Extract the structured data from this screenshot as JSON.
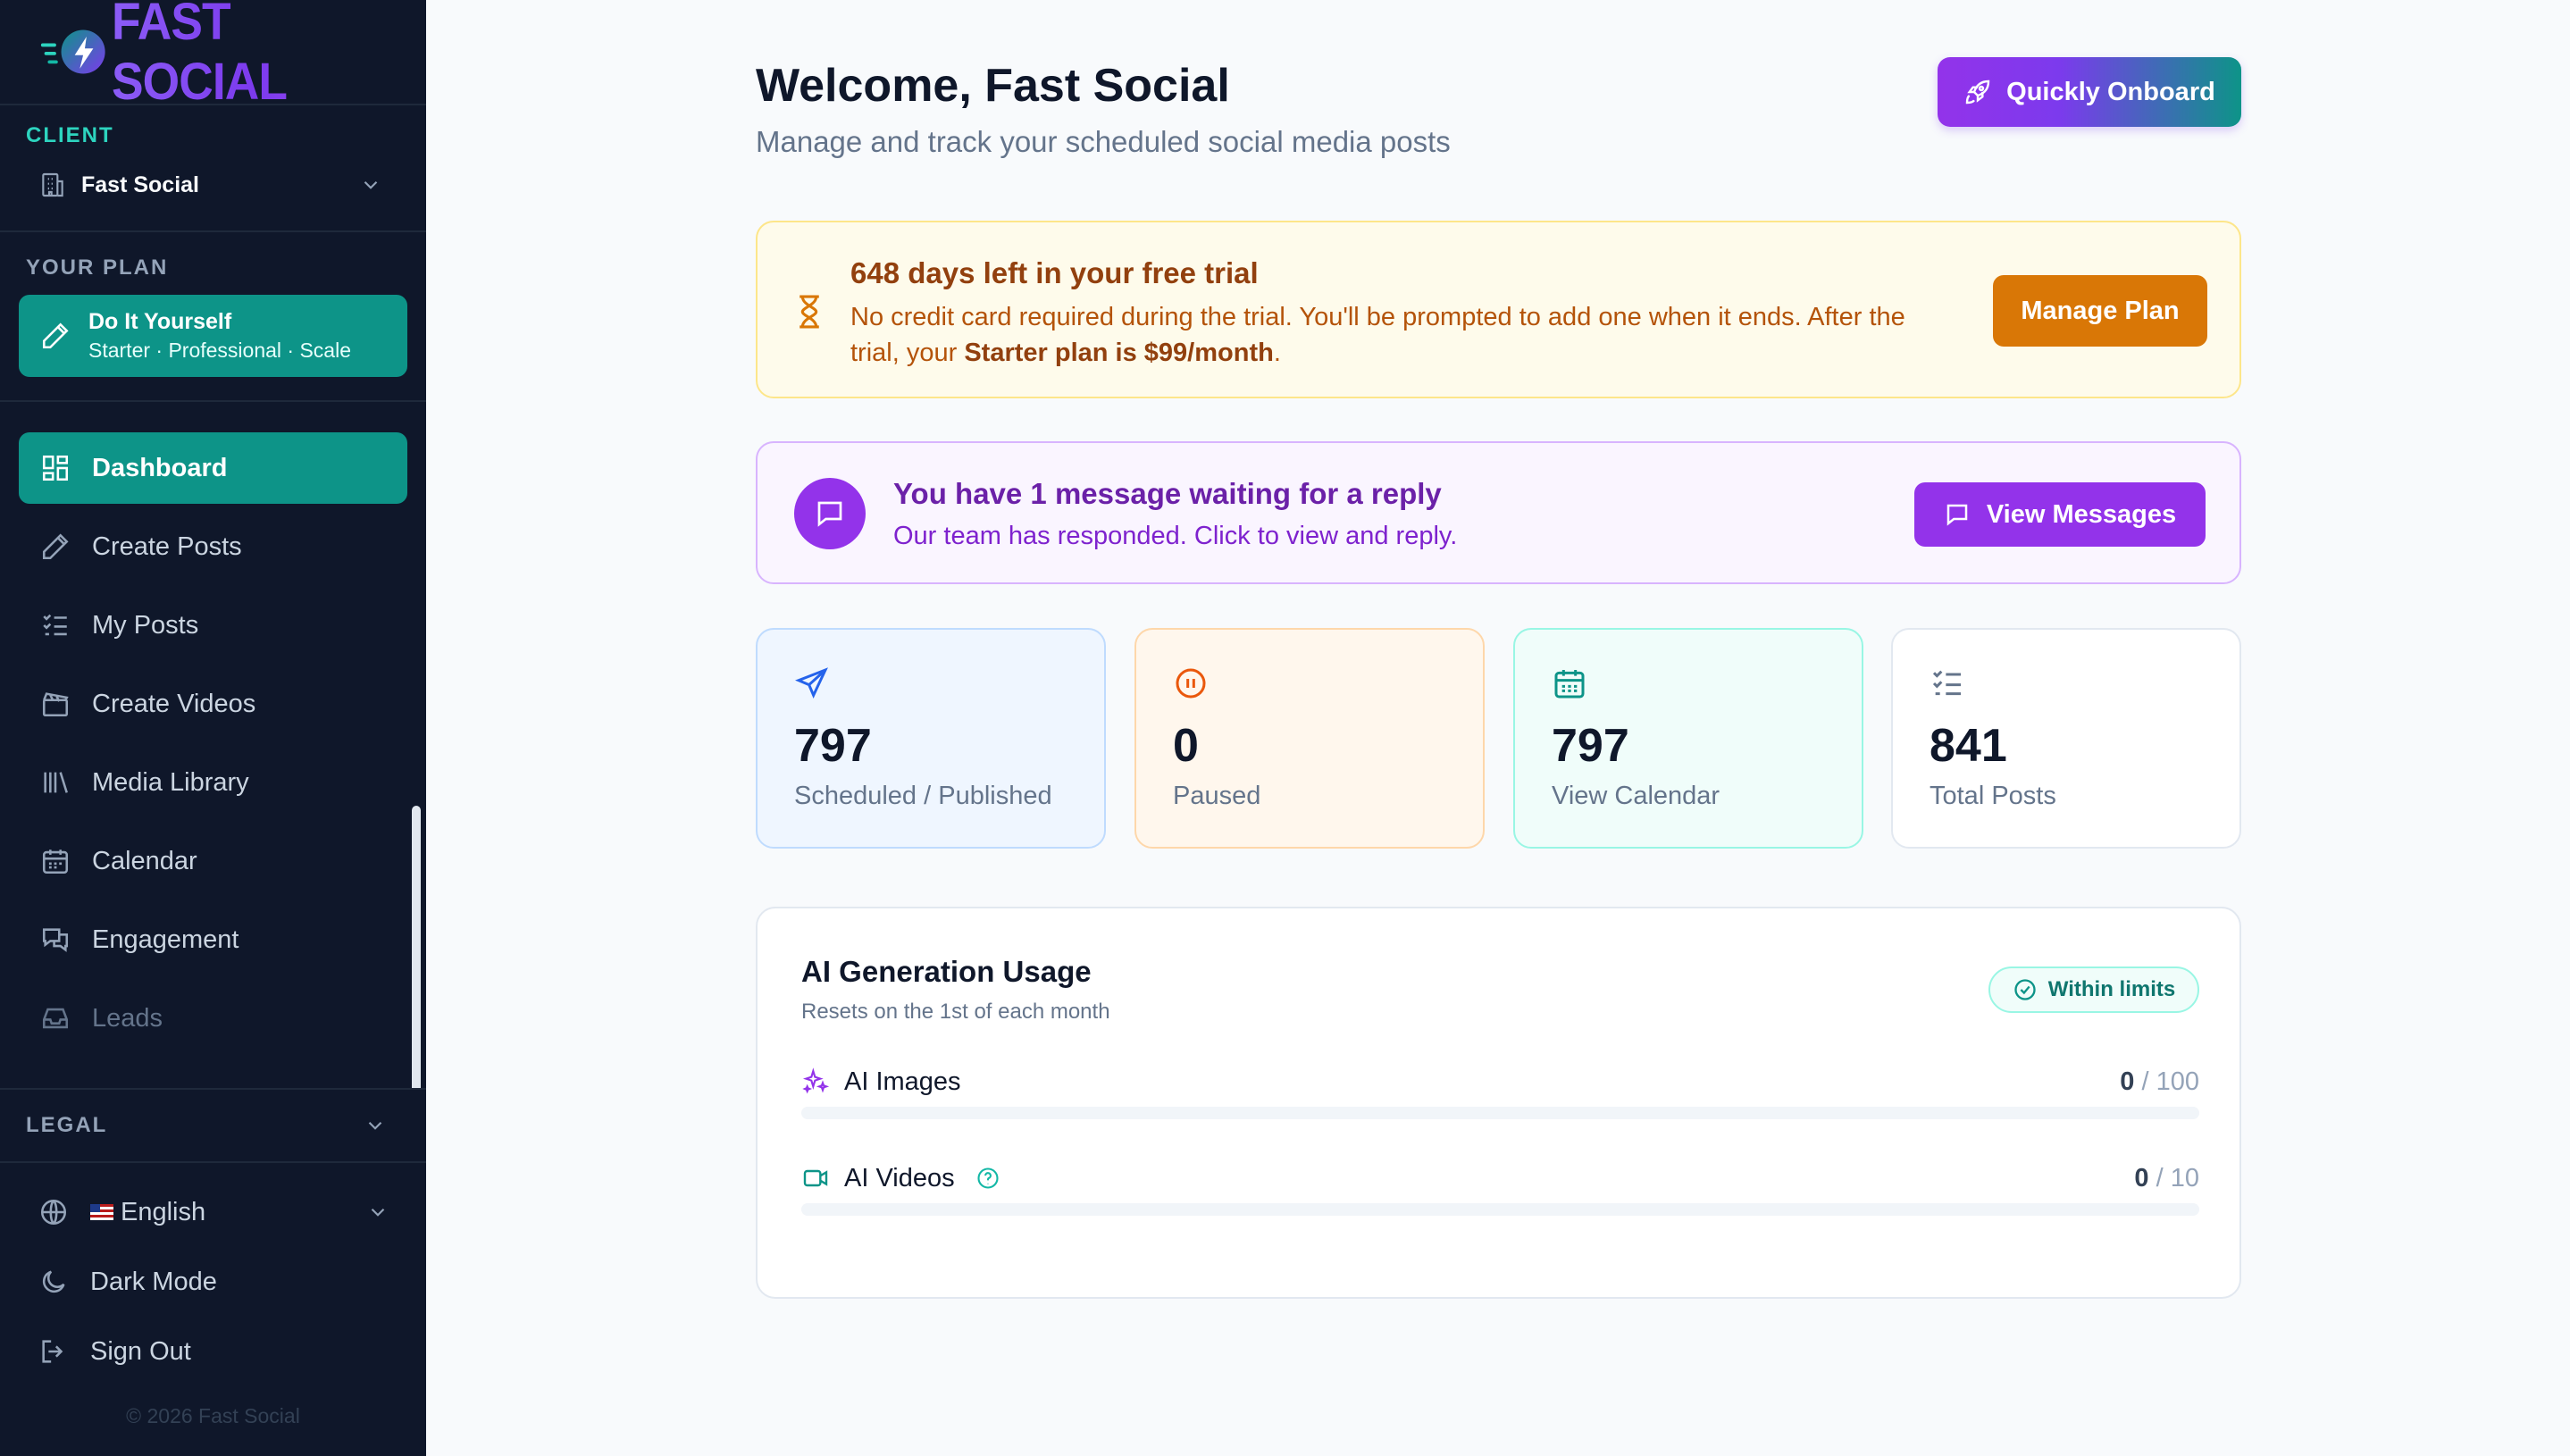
{
  "brand": {
    "name": "FAST SOCIAL"
  },
  "sidebar": {
    "client_label": "CLIENT",
    "client_name": "Fast Social",
    "plan_label": "YOUR PLAN",
    "plan_title": "Do It Yourself",
    "plan_tiers": "Starter · Professional · Scale",
    "nav": [
      {
        "label": "Dashboard",
        "icon": "dashboard-icon",
        "active": true
      },
      {
        "label": "Create Posts",
        "icon": "pencil-icon"
      },
      {
        "label": "My Posts",
        "icon": "checklist-icon"
      },
      {
        "label": "Create Videos",
        "icon": "clapperboard-icon"
      },
      {
        "label": "Media Library",
        "icon": "library-icon"
      },
      {
        "label": "Calendar",
        "icon": "calendar-icon"
      },
      {
        "label": "Engagement",
        "icon": "chat-bubbles-icon"
      },
      {
        "label": "Leads",
        "icon": "inbox-icon"
      }
    ],
    "legal_label": "LEGAL",
    "language": "English",
    "dark_mode": "Dark Mode",
    "sign_out": "Sign Out",
    "copyright": "© 2026 Fast Social"
  },
  "header": {
    "title": "Welcome, Fast Social",
    "subtitle": "Manage and track your scheduled social media posts",
    "onboard_button": "Quickly Onboard"
  },
  "trial": {
    "title": "648 days left in your free trial",
    "text_before": "No credit card required during the trial. You'll be prompted to add one when it ends. After the trial, your ",
    "text_bold": "Starter plan is $99/month",
    "text_after": ".",
    "button": "Manage Plan"
  },
  "messages": {
    "title": "You have 1 message waiting for a reply",
    "text": "Our team has responded. Click to view and reply.",
    "button": "View Messages"
  },
  "stats": [
    {
      "value": "797",
      "label": "Scheduled / Published",
      "icon": "send-icon"
    },
    {
      "value": "0",
      "label": "Paused",
      "icon": "pause-circle-icon"
    },
    {
      "value": "797",
      "label": "View Calendar",
      "icon": "calendar-icon"
    },
    {
      "value": "841",
      "label": "Total Posts",
      "icon": "checklist-icon"
    }
  ],
  "usage": {
    "title": "AI Generation Usage",
    "subtitle": "Resets on the 1st of each month",
    "badge": "Within limits",
    "rows": [
      {
        "label": "AI Images",
        "used": "0",
        "limit": "/ 100",
        "fraction": 0,
        "icon": "sparkles-icon"
      },
      {
        "label": "AI Videos",
        "used": "0",
        "limit": "/ 10",
        "fraction": 0,
        "icon": "video-icon"
      }
    ]
  },
  "colors": {
    "accent": "#0d9488",
    "purple": "#9333ea",
    "amber": "#d97706",
    "sidebar_bg": "#0f172a"
  }
}
